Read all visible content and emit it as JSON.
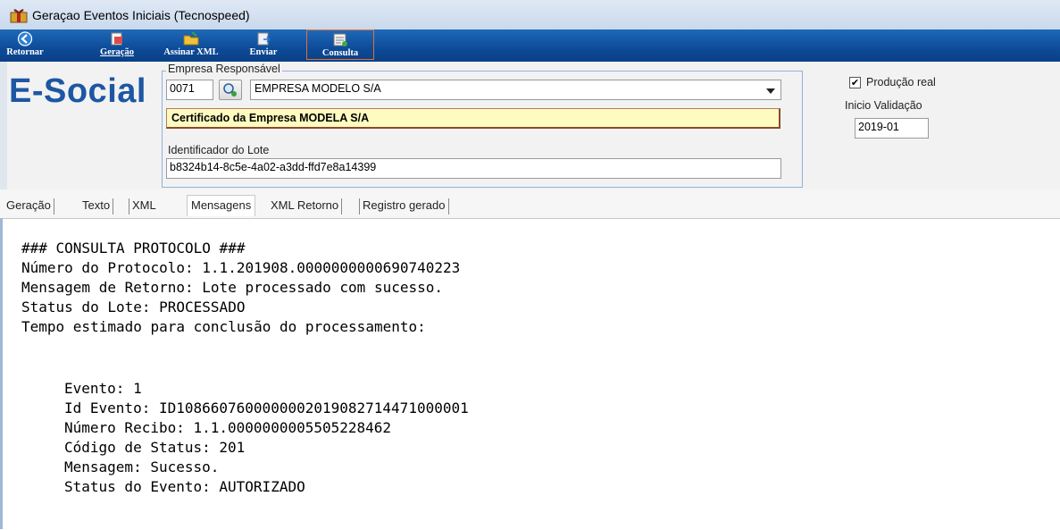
{
  "window": {
    "title": "Geraçao Eventos Iniciais (Tecnospeed)",
    "icon": "gift-icon"
  },
  "toolbar": {
    "buttons": [
      {
        "label": "Retornar",
        "icon": "back-arrow-icon",
        "accent": "Retornar"
      },
      {
        "label": "Geração",
        "icon": "generate-icon"
      },
      {
        "label": "Assinar XML",
        "icon": "folder-sign-icon"
      },
      {
        "label": "Enviar",
        "icon": "send-icon"
      },
      {
        "label": "Consulta",
        "icon": "consult-icon",
        "active": true
      }
    ]
  },
  "header": {
    "brand": "E-Social",
    "group_title": "Empresa Responsável",
    "company_code": "0071",
    "company_name": "EMPRESA MODELO S/A",
    "certificate": "Certificado da Empresa MODELA S/A",
    "lot_label": "Identificador do Lote",
    "lot_id": "b8324b14-8c5e-4a02-a3dd-ffd7e8a14399",
    "production_label": "Produção real",
    "production_checked": true,
    "validation_label": "Inicio Validação",
    "validation_value": "2019-01"
  },
  "tabs": [
    "Geração",
    "Texto",
    "XML",
    "Mensagens",
    "XML Retorno",
    "Registro gerado"
  ],
  "active_tab": "Mensagens",
  "messages": {
    "lines": [
      "### CONSULTA PROTOCOLO ###",
      "Número do Protocolo: 1.1.201908.0000000000690740223",
      "Mensagem de Retorno: Lote processado com sucesso.",
      "Status do Lote: PROCESSADO",
      "Tempo estimado para conclusão do processamento:"
    ],
    "event_lines": [
      "Evento: 1",
      "Id Evento: ID1086607600000002019082714471000001",
      "Número Recibo: 1.1.0000000005505228462",
      "Código de Status: 201",
      "Mensagem: Sucesso.",
      "Status do Evento: AUTORIZADO"
    ]
  },
  "colors": {
    "toolbar": "#0d4b98",
    "brand": "#1d57a3",
    "certificate_bg": "#fdfbbf",
    "active_border": "#e0703a"
  }
}
